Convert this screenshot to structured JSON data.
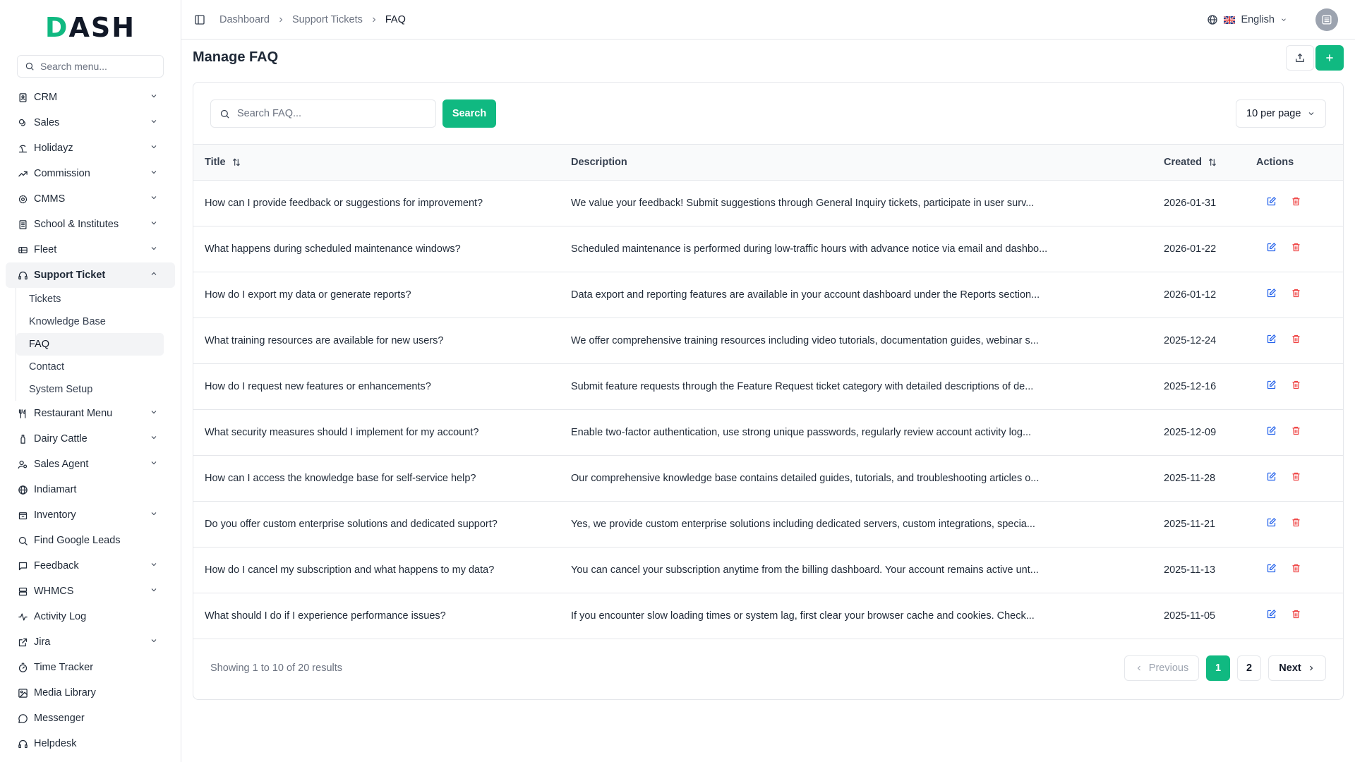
{
  "brand": {
    "logo_prefix": "D",
    "logo_rest": "ASH"
  },
  "sidebar": {
    "search_placeholder": "Search menu...",
    "items": [
      {
        "label": "CRM",
        "icon": "contact-book-icon",
        "chevron": true
      },
      {
        "label": "Sales",
        "icon": "coins-icon",
        "chevron": true
      },
      {
        "label": "Holidayz",
        "icon": "beach-icon",
        "chevron": true
      },
      {
        "label": "Commission",
        "icon": "trend-icon",
        "chevron": true
      },
      {
        "label": "CMMS",
        "icon": "gear-icon",
        "chevron": true
      },
      {
        "label": "School & Institutes",
        "icon": "building-icon",
        "chevron": true
      },
      {
        "label": "Fleet",
        "icon": "truck-icon",
        "chevron": true
      },
      {
        "label": "Support Ticket",
        "icon": "headset-icon",
        "chevron": true,
        "expanded": true
      }
    ],
    "support_sub": [
      "Tickets",
      "Knowledge Base",
      "FAQ",
      "Contact",
      "System Setup"
    ],
    "active_sub": "FAQ",
    "items_after": [
      {
        "label": "Restaurant Menu",
        "icon": "utensils-icon",
        "chevron": true
      },
      {
        "label": "Dairy Cattle",
        "icon": "bottle-icon",
        "chevron": true
      },
      {
        "label": "Sales Agent",
        "icon": "user-agent-icon",
        "chevron": true
      },
      {
        "label": "Indiamart",
        "icon": "globe-icon",
        "chevron": false
      },
      {
        "label": "Inventory",
        "icon": "box-icon",
        "chevron": true
      },
      {
        "label": "Find Google Leads",
        "icon": "search-icon",
        "chevron": false
      },
      {
        "label": "Feedback",
        "icon": "message-icon",
        "chevron": true
      },
      {
        "label": "WHMCS",
        "icon": "server-icon",
        "chevron": true
      },
      {
        "label": "Activity Log",
        "icon": "activity-icon",
        "chevron": false
      },
      {
        "label": "Jira",
        "icon": "external-link-icon",
        "chevron": true
      },
      {
        "label": "Time Tracker",
        "icon": "timer-icon",
        "chevron": false
      },
      {
        "label": "Media Library",
        "icon": "image-icon",
        "chevron": false
      },
      {
        "label": "Messenger",
        "icon": "chat-icon",
        "chevron": false
      },
      {
        "label": "Helpdesk",
        "icon": "headset-icon",
        "chevron": false
      }
    ]
  },
  "topbar": {
    "breadcrumbs": [
      "Dashboard",
      "Support Tickets",
      "FAQ"
    ],
    "language": "English"
  },
  "page": {
    "title": "Manage FAQ"
  },
  "toolbar": {
    "search_placeholder": "Search FAQ...",
    "search_button": "Search",
    "per_page": "10 per page"
  },
  "table": {
    "headers": {
      "title": "Title",
      "description": "Description",
      "created": "Created",
      "actions": "Actions"
    },
    "rows": [
      {
        "title": "How can I provide feedback or suggestions for improvement?",
        "description": "We value your feedback! Submit suggestions through General Inquiry tickets, participate in user surv...",
        "created": "2026-01-31"
      },
      {
        "title": "What happens during scheduled maintenance windows?",
        "description": "Scheduled maintenance is performed during low-traffic hours with advance notice via email and dashbo...",
        "created": "2026-01-22"
      },
      {
        "title": "How do I export my data or generate reports?",
        "description": "Data export and reporting features are available in your account dashboard under the Reports section...",
        "created": "2026-01-12"
      },
      {
        "title": "What training resources are available for new users?",
        "description": "We offer comprehensive training resources including video tutorials, documentation guides, webinar s...",
        "created": "2025-12-24"
      },
      {
        "title": "How do I request new features or enhancements?",
        "description": "Submit feature requests through the Feature Request ticket category with detailed descriptions of de...",
        "created": "2025-12-16"
      },
      {
        "title": "What security measures should I implement for my account?",
        "description": "Enable two-factor authentication, use strong unique passwords, regularly review account activity log...",
        "created": "2025-12-09"
      },
      {
        "title": "How can I access the knowledge base for self-service help?",
        "description": "Our comprehensive knowledge base contains detailed guides, tutorials, and troubleshooting articles o...",
        "created": "2025-11-28"
      },
      {
        "title": "Do you offer custom enterprise solutions and dedicated support?",
        "description": "Yes, we provide custom enterprise solutions including dedicated servers, custom integrations, specia...",
        "created": "2025-11-21"
      },
      {
        "title": "How do I cancel my subscription and what happens to my data?",
        "description": "You can cancel your subscription anytime from the billing dashboard. Your account remains active unt...",
        "created": "2025-11-13"
      },
      {
        "title": "What should I do if I experience performance issues?",
        "description": "If you encounter slow loading times or system lag, first clear your browser cache and cookies. Check...",
        "created": "2025-11-05"
      }
    ]
  },
  "pagination": {
    "summary": "Showing 1 to 10 of 20 results",
    "previous": "Previous",
    "pages": [
      "1",
      "2"
    ],
    "current": "1",
    "next": "Next"
  },
  "colors": {
    "accent": "#10b981",
    "danger": "#ef4444",
    "edit": "#2563eb"
  }
}
